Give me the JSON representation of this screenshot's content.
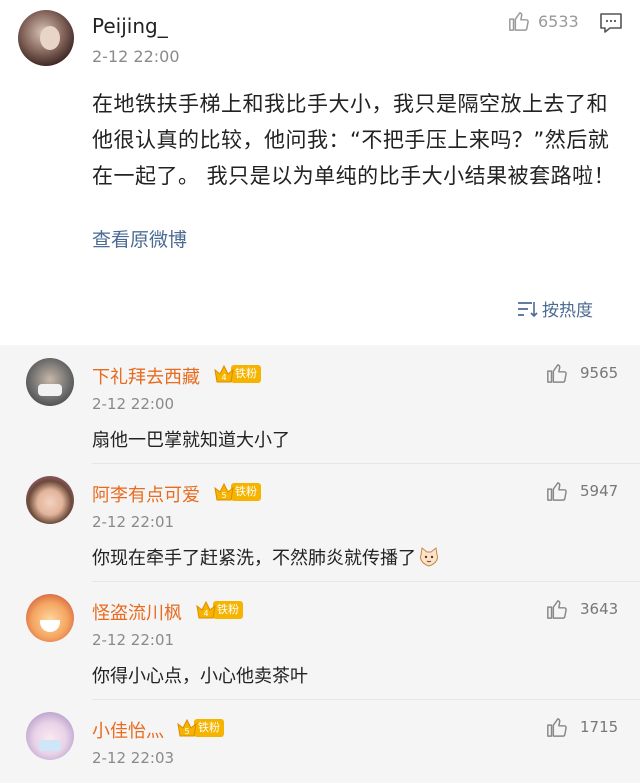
{
  "post": {
    "username": "Peijing_",
    "time": "2-12 22:00",
    "likes": "6533",
    "text": "在地铁扶手梯上和我比手大小，我只是隔空放上去了和他很认真的比较，他问我：“不把手压上来吗？”然后就在一起了。 我只是以为单纯的比手大小结果被套路啦！",
    "view_original": "查看原微博"
  },
  "sort": {
    "label": "按热度"
  },
  "badge_label": "铁粉",
  "comments": [
    {
      "name": "下礼拜去西藏",
      "badge_level": "4",
      "time": "2-12 22:00",
      "likes": "9565",
      "text": "扇他一巴掌就知道大小了"
    },
    {
      "name": "阿李有点可爱",
      "badge_level": "5",
      "time": "2-12 22:01",
      "likes": "5947",
      "text": "你现在牵手了赶紧洗，不然肺炎就传播了"
    },
    {
      "name": "怪盗流川枫",
      "badge_level": "4",
      "time": "2-12 22:01",
      "likes": "3643",
      "text": "你得小心点，小心他卖茶叶"
    },
    {
      "name": "小佳怡灬",
      "badge_level": "5",
      "time": "2-12 22:03",
      "likes": "1715",
      "text": ""
    }
  ],
  "colors": {
    "username_orange": "#e86b1f",
    "link_blue": "#4c6b94",
    "badge_gold": "#f5b400"
  }
}
